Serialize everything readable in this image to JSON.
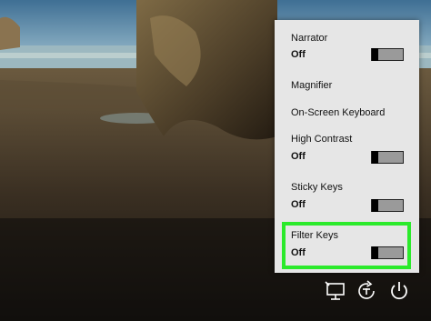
{
  "accessibility_menu": {
    "items": [
      {
        "label": "Narrator",
        "state": "Off",
        "has_toggle": true
      },
      {
        "label": "Magnifier",
        "has_toggle": false
      },
      {
        "label": "On-Screen Keyboard",
        "has_toggle": false
      },
      {
        "label": "High Contrast",
        "state": "Off",
        "has_toggle": true
      },
      {
        "label": "Sticky Keys",
        "state": "Off",
        "has_toggle": true
      },
      {
        "label": "Filter Keys",
        "state": "Off",
        "has_toggle": true
      }
    ]
  },
  "highlight_color": "#2bea2b",
  "tray": {
    "icons": [
      "network-icon",
      "ease-of-access-icon",
      "power-icon"
    ]
  }
}
